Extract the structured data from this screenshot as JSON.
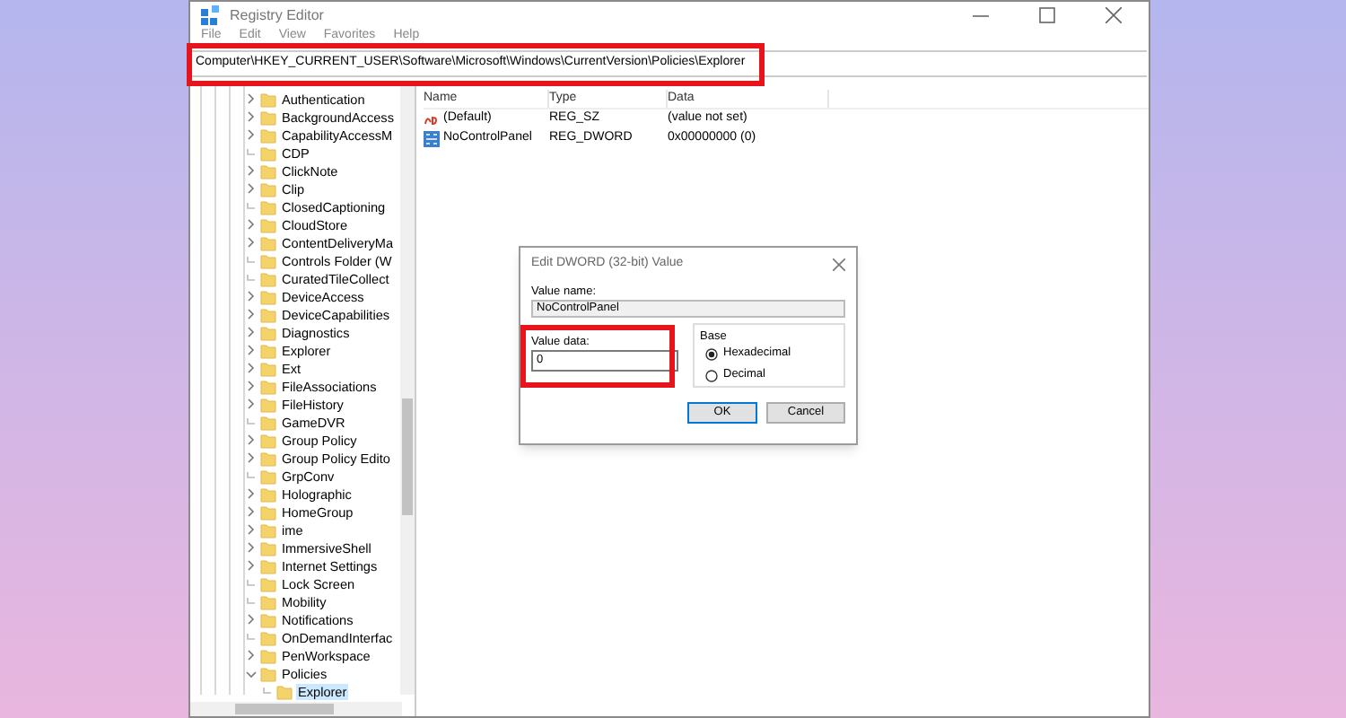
{
  "window": {
    "title": "Registry Editor"
  },
  "menu": [
    "File",
    "Edit",
    "View",
    "Favorites",
    "Help"
  ],
  "address": "Computer\\HKEY_CURRENT_USER\\Software\\Microsoft\\Windows\\CurrentVersion\\Policies\\Explorer",
  "tree": [
    {
      "label": "Authentication",
      "expandable": true
    },
    {
      "label": "BackgroundAccess",
      "expandable": true
    },
    {
      "label": "CapabilityAccessM",
      "expandable": true
    },
    {
      "label": "CDP",
      "expandable": false
    },
    {
      "label": "ClickNote",
      "expandable": true
    },
    {
      "label": "Clip",
      "expandable": true
    },
    {
      "label": "ClosedCaptioning",
      "expandable": false
    },
    {
      "label": "CloudStore",
      "expandable": true
    },
    {
      "label": "ContentDeliveryMa",
      "expandable": true
    },
    {
      "label": "Controls Folder (W",
      "expandable": false
    },
    {
      "label": "CuratedTileCollect",
      "expandable": false
    },
    {
      "label": "DeviceAccess",
      "expandable": true
    },
    {
      "label": "DeviceCapabilities",
      "expandable": true
    },
    {
      "label": "Diagnostics",
      "expandable": true
    },
    {
      "label": "Explorer",
      "expandable": true
    },
    {
      "label": "Ext",
      "expandable": true
    },
    {
      "label": "FileAssociations",
      "expandable": true
    },
    {
      "label": "FileHistory",
      "expandable": true
    },
    {
      "label": "GameDVR",
      "expandable": false
    },
    {
      "label": "Group Policy",
      "expandable": true
    },
    {
      "label": "Group Policy Edito",
      "expandable": true
    },
    {
      "label": "GrpConv",
      "expandable": false
    },
    {
      "label": "Holographic",
      "expandable": true
    },
    {
      "label": "HomeGroup",
      "expandable": true
    },
    {
      "label": "ime",
      "expandable": true
    },
    {
      "label": "ImmersiveShell",
      "expandable": true
    },
    {
      "label": "Internet Settings",
      "expandable": true
    },
    {
      "label": "Lock Screen",
      "expandable": false
    },
    {
      "label": "Mobility",
      "expandable": false
    },
    {
      "label": "Notifications",
      "expandable": true
    },
    {
      "label": "OnDemandInterfac",
      "expandable": false
    },
    {
      "label": "PenWorkspace",
      "expandable": true
    },
    {
      "label": "Policies",
      "expandable": true,
      "expanded": true,
      "children": [
        {
          "label": "Explorer",
          "expandable": false,
          "selected": true
        }
      ]
    }
  ],
  "values": {
    "columns": [
      "Name",
      "Type",
      "Data"
    ],
    "rows": [
      {
        "kind": "string",
        "name": "(Default)",
        "type": "REG_SZ",
        "data": "(value not set)"
      },
      {
        "kind": "binary",
        "name": "NoControlPanel",
        "type": "REG_DWORD",
        "data": "0x00000000 (0)"
      }
    ]
  },
  "dialog": {
    "title": "Edit DWORD (32-bit) Value",
    "value_name_label": "Value name:",
    "value_name": "NoControlPanel",
    "value_data_label": "Value data:",
    "value_data": "0",
    "base_label": "Base",
    "base_options": [
      {
        "label": "Hexadecimal",
        "selected": true
      },
      {
        "label": "Decimal",
        "selected": false
      }
    ],
    "buttons": [
      "OK",
      "Cancel"
    ]
  }
}
